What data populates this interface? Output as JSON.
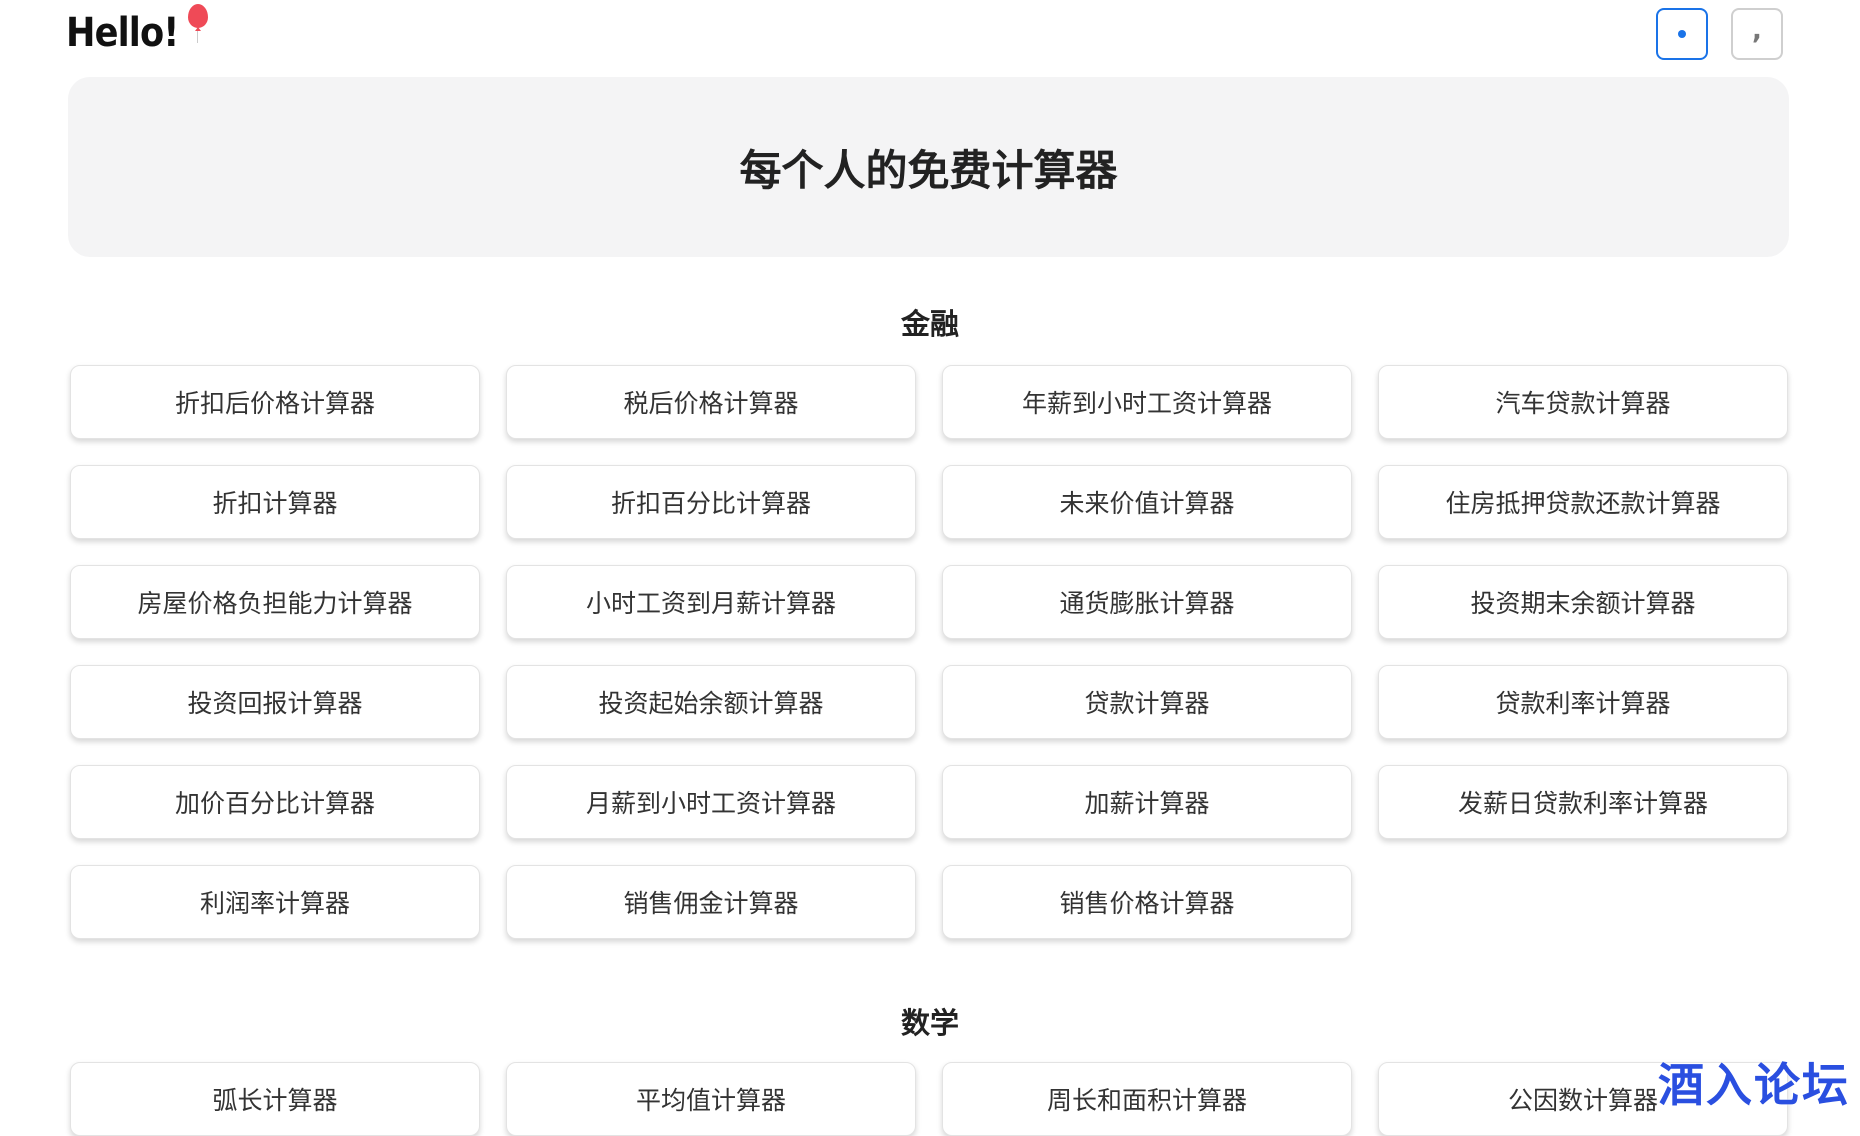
{
  "header": {
    "logo_text": "Hello!",
    "logo_icon": "balloon-icon",
    "button_primary_icon": "dot-icon",
    "button_secondary_icon": "comma-icon",
    "button_secondary_glyph": ","
  },
  "hero": {
    "title": "每个人的免费计算器"
  },
  "sections": {
    "finance": {
      "title": "金融",
      "items": [
        "折扣后价格计算器",
        "税后价格计算器",
        "年薪到小时工资计算器",
        "汽车贷款计算器",
        "折扣计算器",
        "折扣百分比计算器",
        "未来价值计算器",
        "住房抵押贷款还款计算器",
        "房屋价格负担能力计算器",
        "小时工资到月薪计算器",
        "通货膨胀计算器",
        "投资期末余额计算器",
        "投资回报计算器",
        "投资起始余额计算器",
        "贷款计算器",
        "贷款利率计算器",
        "加价百分比计算器",
        "月薪到小时工资计算器",
        "加薪计算器",
        "发薪日贷款利率计算器",
        "利润率计算器",
        "销售佣金计算器",
        "销售价格计算器"
      ]
    },
    "math": {
      "title": "数学",
      "items": [
        "弧长计算器",
        "平均值计算器",
        "周长和面积计算器",
        "公因数计算器"
      ]
    }
  },
  "watermark": {
    "text": "酒入论坛"
  },
  "colors": {
    "accent": "#1a73e8",
    "hero_bg": "#f4f4f5",
    "balloon": "#ef4a57",
    "watermark": "#2a4fe0"
  }
}
